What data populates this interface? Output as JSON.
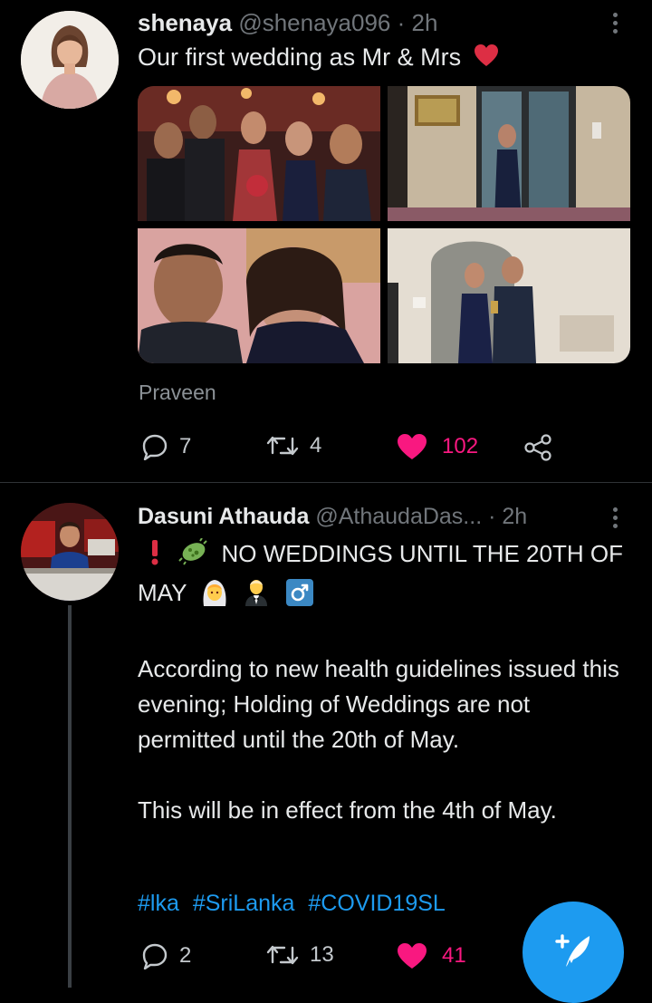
{
  "tweets": [
    {
      "display_name": "shenaya",
      "handle": "@shenaya096",
      "time": "· 2h",
      "text": "Our first wedding as Mr & Mrs",
      "text_emoji": "red-heart",
      "tagged": "Praveen",
      "replies": "7",
      "retweets": "4",
      "likes": "102",
      "liked": true
    },
    {
      "display_name": "Dasuni Athauda",
      "handle": "@AthaudaDas...",
      "time": "· 2h",
      "headline_emojis": [
        "exclamation",
        "microbe"
      ],
      "headline": "NO WEDDINGS UNTIL THE 20TH OF MAY",
      "headline_trailing_emojis": [
        "bride-with-veil",
        "man-in-tuxedo",
        "male-sign"
      ],
      "paragraph1": "According to new health guidelines issued this evening; Holding of Weddings are not permitted until the 20th of May.",
      "paragraph2": "This will be in effect from the 4th of May.",
      "hashtags": [
        "#lka",
        "#SriLanka",
        "#COVID19SL"
      ],
      "replies": "2",
      "retweets": "13",
      "likes": "41",
      "liked": true
    }
  ],
  "colors": {
    "background": "#000000",
    "text": "#e7e9ea",
    "secondary": "#71767b",
    "like": "#f91880",
    "link": "#1d9bf0",
    "fab": "#1d9bf0"
  },
  "icons": {
    "reply": "reply-icon",
    "retweet": "retweet-icon",
    "like": "heart-icon",
    "share": "share-icon",
    "more": "more-vertical-icon",
    "compose": "compose-icon"
  }
}
